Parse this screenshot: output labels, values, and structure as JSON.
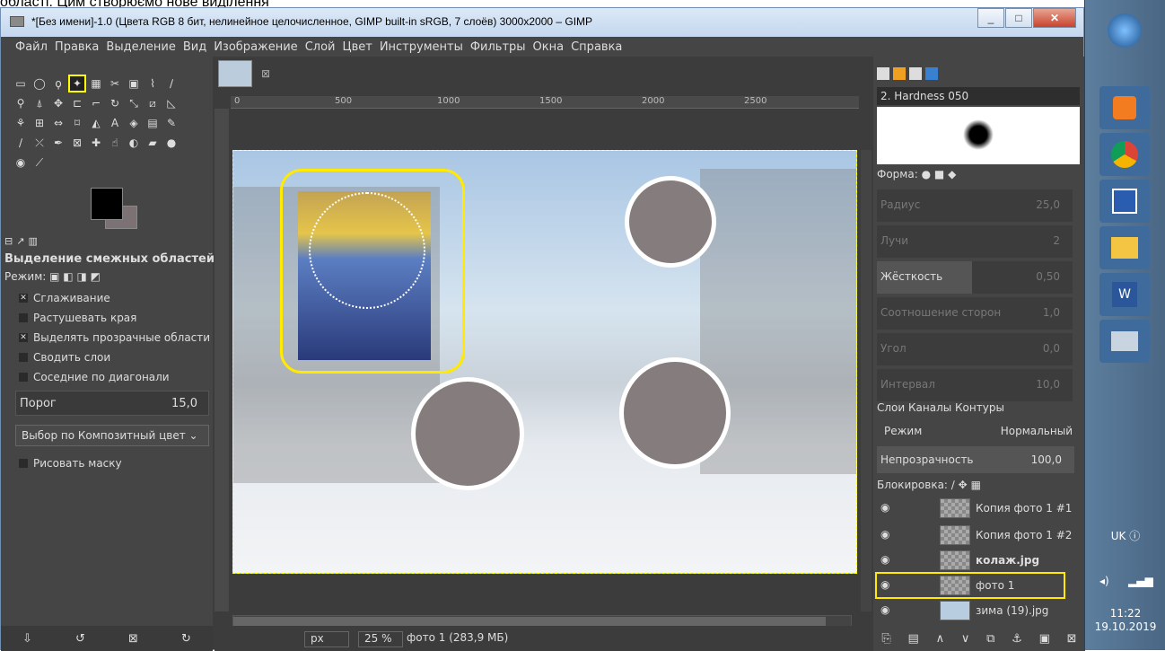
{
  "caption": "області. Цим створюємо нове виділення",
  "window": {
    "title": "*[Без имени]-1.0 (Цвета RGB 8 бит, нелинейное целочисленное, GIMP built-in sRGB, 7 слоёв) 3000x2000 – GIMP"
  },
  "menu": [
    "Файл",
    "Правка",
    "Выделение",
    "Вид",
    "Изображение",
    "Слой",
    "Цвет",
    "Инструменты",
    "Фильтры",
    "Окна",
    "Справка"
  ],
  "toolbox": {
    "title": "Выделение смежных областей",
    "mode_label": "Режим:",
    "options": [
      {
        "label": "Сглаживание",
        "checked": true
      },
      {
        "label": "Растушевать края",
        "checked": false
      },
      {
        "label": "Выделять прозрачные области",
        "checked": true
      },
      {
        "label": "Сводить слои",
        "checked": false
      },
      {
        "label": "Соседние по диагонали",
        "checked": false
      }
    ],
    "threshold_label": "Порог",
    "threshold_value": "15,0",
    "select_by": "Выбор по  Композитный цвет",
    "draw_mask": "Рисовать маску"
  },
  "ruler": [
    "0",
    "500",
    "1000",
    "1500",
    "2000",
    "2500"
  ],
  "status": {
    "unit": "px",
    "zoom": "25 %",
    "info": "фото 1 (283,9 МБ)"
  },
  "brushes": {
    "name": "2. Hardness 050",
    "shape_label": "Форма:",
    "sliders": [
      {
        "label": "Радиус",
        "value": "25,0"
      },
      {
        "label": "Лучи",
        "value": "2"
      },
      {
        "label": "Жёсткость",
        "value": "0,50"
      },
      {
        "label": "Соотношение сторон",
        "value": "1,0"
      },
      {
        "label": "Угол",
        "value": "0,0"
      },
      {
        "label": "Интервал",
        "value": "10,0"
      }
    ]
  },
  "layers": {
    "tabs": "Слои  Каналы  Контуры",
    "mode_label": "Режим",
    "mode_value": "Нормальный",
    "opacity_label": "Непрозрачность",
    "opacity_value": "100,0",
    "lock_label": "Блокировка:",
    "items": [
      {
        "name": "Копия фото 1 #1"
      },
      {
        "name": "Копия фото 1 #2"
      },
      {
        "name": "колаж.jpg"
      },
      {
        "name": "фото 1"
      },
      {
        "name": "зима (19).jpg"
      }
    ]
  },
  "taskbar": {
    "lang": "UK",
    "time": "11:22",
    "date": "19.10.2019"
  }
}
